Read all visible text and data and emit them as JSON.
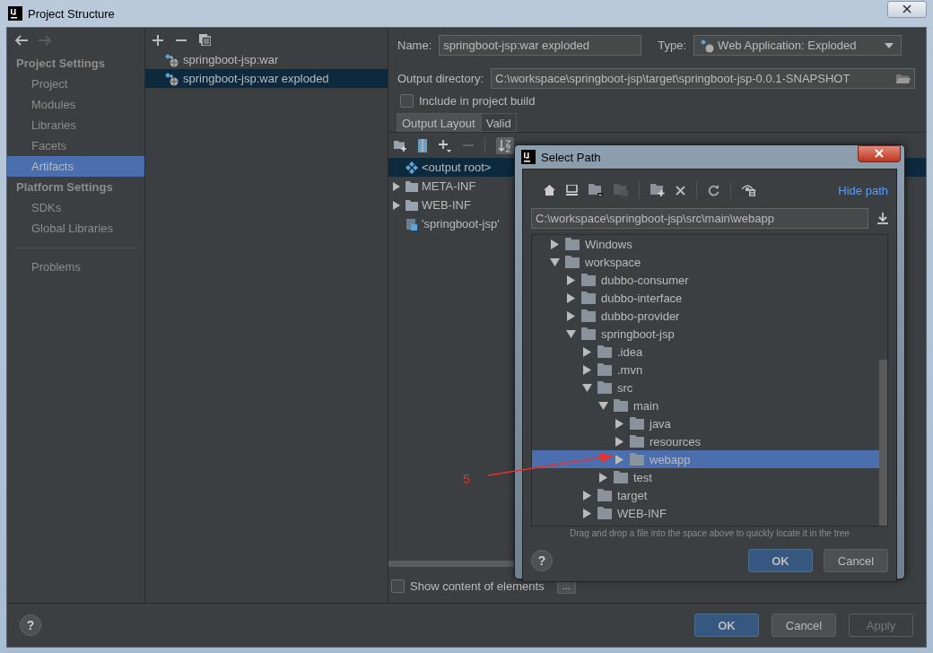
{
  "window": {
    "title": "Project Structure"
  },
  "nav": {
    "back_enabled": true,
    "forward_enabled": false
  },
  "sidebar": {
    "sections": [
      {
        "title": "Project Settings",
        "items": [
          {
            "label": "Project",
            "selected": false
          },
          {
            "label": "Modules",
            "selected": false
          },
          {
            "label": "Libraries",
            "selected": false
          },
          {
            "label": "Facets",
            "selected": false
          },
          {
            "label": "Artifacts",
            "selected": true
          }
        ]
      },
      {
        "title": "Platform Settings",
        "items": [
          {
            "label": "SDKs",
            "selected": false
          },
          {
            "label": "Global Libraries",
            "selected": false
          }
        ]
      }
    ],
    "extra_items": [
      {
        "label": "Problems",
        "selected": false
      }
    ]
  },
  "artifacts": [
    {
      "label": "springboot-jsp:war",
      "selected": false
    },
    {
      "label": "springboot-jsp:war exploded",
      "selected": true
    }
  ],
  "details": {
    "name_label": "Name:",
    "name_value": "springboot-jsp:war exploded",
    "type_label": "Type:",
    "type_value": "Web Application: Exploded",
    "output_label": "Output directory:",
    "output_value": "C:\\workspace\\springboot-jsp\\target\\springboot-jsp-0.0.1-SNAPSHOT",
    "include_build": {
      "label": "Include in project build",
      "checked": false
    },
    "tabs": [
      {
        "label": "Output Layout",
        "selected": true
      },
      {
        "label": "Valid",
        "selected": false
      }
    ],
    "layout_tree": [
      {
        "kind": "root",
        "label": "<output root>",
        "selected": true
      },
      {
        "kind": "folder",
        "label": "META-INF",
        "selected": false
      },
      {
        "kind": "folder",
        "label": "WEB-INF",
        "selected": false
      },
      {
        "kind": "module",
        "label": "'springboot-jsp'",
        "selected": false
      }
    ],
    "show_content": {
      "label": "Show content of elements",
      "checked": false
    },
    "more_button": "..."
  },
  "footer": {
    "help": "?",
    "buttons": [
      {
        "label": "OK",
        "kind": "primary",
        "disabled": false
      },
      {
        "label": "Cancel",
        "kind": "normal",
        "disabled": false
      },
      {
        "label": "Apply",
        "kind": "normal",
        "disabled": true
      }
    ]
  },
  "dialog": {
    "title": "Select Path",
    "hide_path": "Hide path",
    "path": "C:\\workspace\\springboot-jsp\\src\\main\\webapp",
    "tree": [
      {
        "label": "Windows",
        "expanded": false,
        "selected": false
      },
      {
        "label": "workspace",
        "expanded": true,
        "selected": false,
        "children": [
          {
            "label": "dubbo-consumer",
            "expanded": false,
            "selected": false
          },
          {
            "label": "dubbo-interface",
            "expanded": false,
            "selected": false
          },
          {
            "label": "dubbo-provider",
            "expanded": false,
            "selected": false
          },
          {
            "label": "springboot-jsp",
            "expanded": true,
            "selected": false,
            "children": [
              {
                "label": ".idea",
                "expanded": false,
                "selected": false
              },
              {
                "label": ".mvn",
                "expanded": false,
                "selected": false
              },
              {
                "label": "src",
                "expanded": true,
                "selected": false,
                "children": [
                  {
                    "label": "main",
                    "expanded": true,
                    "selected": false,
                    "children": [
                      {
                        "label": "java",
                        "expanded": false,
                        "selected": false
                      },
                      {
                        "label": "resources",
                        "expanded": false,
                        "selected": false
                      },
                      {
                        "label": "webapp",
                        "expanded": false,
                        "selected": true
                      }
                    ]
                  },
                  {
                    "label": "test",
                    "expanded": false,
                    "selected": false
                  }
                ]
              },
              {
                "label": "target",
                "expanded": false,
                "selected": false
              },
              {
                "label": "WEB-INF",
                "expanded": false,
                "selected": false
              }
            ]
          }
        ]
      }
    ],
    "hint": "Drag and drop a file into the space above to quickly locate it in the tree",
    "help": "?",
    "ok": "OK",
    "cancel": "Cancel"
  },
  "annotation": {
    "label": "5"
  }
}
